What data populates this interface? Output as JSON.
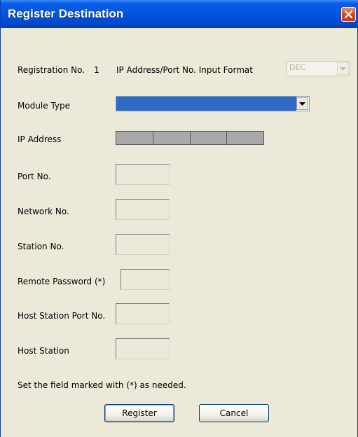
{
  "window": {
    "title": "Register Destination"
  },
  "form": {
    "registration_no_label": "Registration No.",
    "registration_no_value": "1",
    "input_format_label": "IP Address/Port No. Input Format",
    "input_format_value": "DEC",
    "module_type_label": "Module Type",
    "module_type_value": "",
    "ip_address_label": "IP Address",
    "port_no_label": "Port No.",
    "network_no_label": "Network No.",
    "station_no_label": "Station No.",
    "remote_password_label": "Remote Password (*)",
    "host_station_port_no_label": "Host Station Port No.",
    "host_station_label": "Host Station",
    "note": "Set the field marked with (*) as needed."
  },
  "buttons": {
    "register": "Register",
    "cancel": "Cancel"
  },
  "colors": {
    "titlebar": "#0254e0",
    "dialog_bg": "#ece9d8",
    "selection": "#316ac5",
    "close_button": "#d9461f"
  },
  "icons": {
    "close": "close-icon",
    "dropdown": "chevron-down-icon"
  }
}
